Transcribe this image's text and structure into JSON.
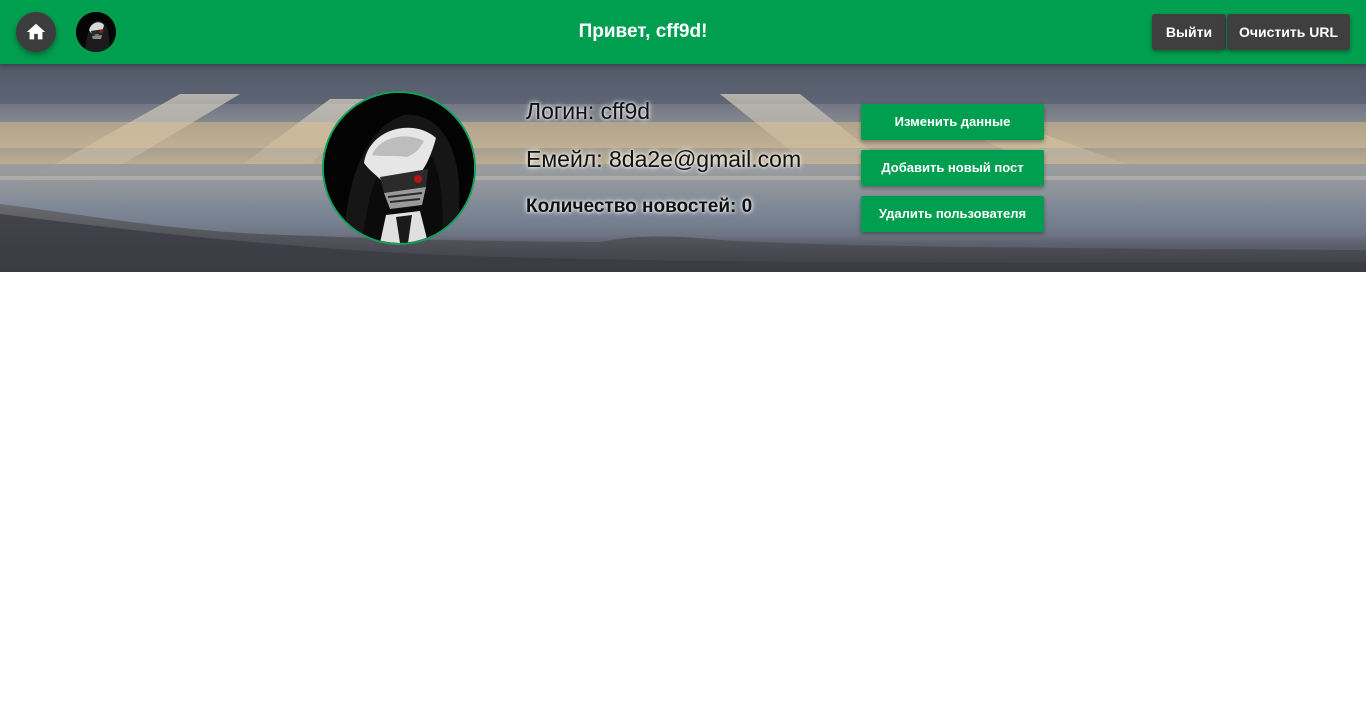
{
  "header": {
    "greeting": "Привет, cff9d!",
    "logout_label": "Выйти",
    "clear_url_label": "Очистить URL",
    "home_icon": "home-icon",
    "avatar_icon": "user-avatar",
    "background_color": "#009e4f",
    "dark_button_color": "#3f3f3f"
  },
  "profile": {
    "login_text": "Логин: cff9d",
    "email_text": "Емейл: 8da2e@gmail.com",
    "news_count_text": "Количество новостей: 0",
    "avatar_icon": "profile-avatar"
  },
  "actions": {
    "edit_label": "Изменить данные",
    "add_post_label": "Добавить новый пост",
    "delete_user_label": "Удалить пользователя",
    "accent_color": "#009e4f"
  }
}
